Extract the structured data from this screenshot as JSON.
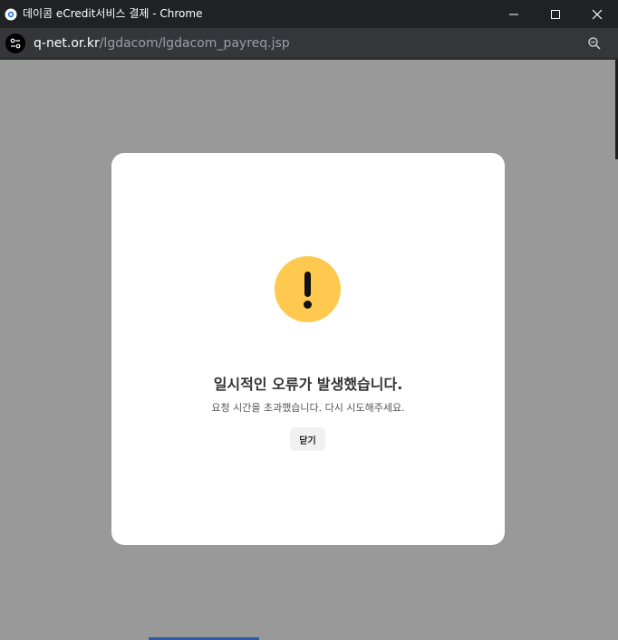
{
  "window": {
    "title": "데이콤 eCredit서비스 결제 - Chrome",
    "buttons": {
      "minimize": "minimize-icon",
      "maximize": "maximize-icon",
      "close": "close-icon"
    }
  },
  "address_bar": {
    "url_host": "q-net.or.kr",
    "url_path": "/lgdacom/lgdacom_payreq.jsp",
    "site_info_icon": "tune-icon",
    "zoom_icon": "zoom-out-icon"
  },
  "modal": {
    "icon": "warning-icon",
    "title": "일시적인 오류가 발생했습니다.",
    "message": "요청 시간을 초과했습니다. 다시 시도해주세요.",
    "close_label": "닫기"
  },
  "colors": {
    "titlebar": "#202124",
    "addressbar": "#35363a",
    "overlay": "#999999",
    "modal": "#ffffff",
    "warning": "#ffc94f",
    "button": "#f1f1f1"
  }
}
